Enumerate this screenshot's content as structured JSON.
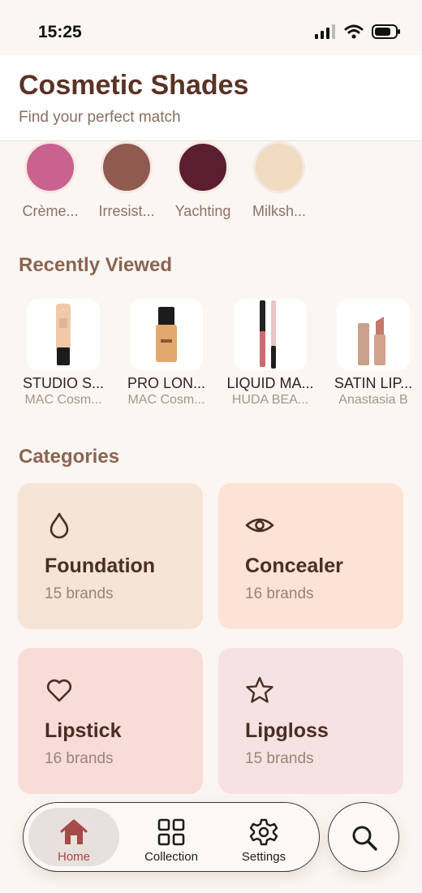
{
  "status": {
    "time": "15:25"
  },
  "header": {
    "title": "Cosmetic Shades",
    "subtitle": "Find your perfect match"
  },
  "shades": [
    {
      "name": "Crème...",
      "color": "#c9628e"
    },
    {
      "name": "Irresist...",
      "color": "#8f5a4f"
    },
    {
      "name": "Yachting",
      "color": "#5a1e30"
    },
    {
      "name": "Milksh...",
      "color": "#f0dcc0"
    }
  ],
  "recently_viewed": {
    "title": "Recently Viewed",
    "items": [
      {
        "name": "STUDIO S...",
        "brand": "MAC Cosm..."
      },
      {
        "name": "PRO LON...",
        "brand": "MAC Cosm..."
      },
      {
        "name": "LIQUID MA...",
        "brand": "HUDA BEA..."
      },
      {
        "name": "SATIN LIP...",
        "brand": "Anastasia B"
      }
    ]
  },
  "categories": {
    "title": "Categories",
    "items": [
      {
        "name": "Foundation",
        "count": "15 brands",
        "color": "#f6e4d6",
        "icon": "drop-icon"
      },
      {
        "name": "Concealer",
        "count": "16 brands",
        "color": "#fde3d6",
        "icon": "eye-icon"
      },
      {
        "name": "Lipstick",
        "count": "16 brands",
        "color": "#f8dcd8",
        "icon": "heart-icon"
      },
      {
        "name": "Lipgloss",
        "count": "15 brands",
        "color": "#f7e2e3",
        "icon": "star-icon"
      }
    ]
  },
  "tabbar": {
    "tabs": [
      {
        "label": "Home",
        "icon": "home-icon",
        "active": true
      },
      {
        "label": "Collection",
        "icon": "grid-icon",
        "active": false
      },
      {
        "label": "Settings",
        "icon": "gear-icon",
        "active": false
      }
    ],
    "search_icon": "search-icon"
  },
  "colors": {
    "accent": "#a44a47",
    "title": "#5a3325"
  }
}
